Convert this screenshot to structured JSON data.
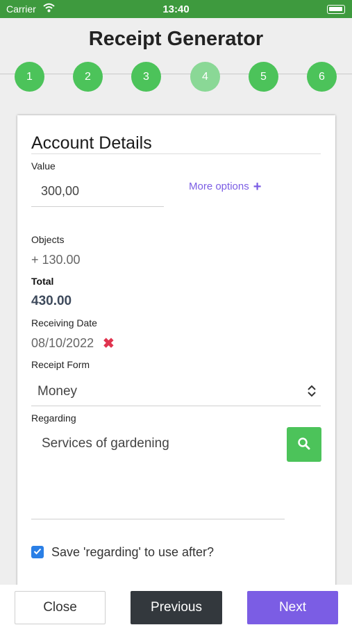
{
  "status_bar": {
    "carrier": "Carrier",
    "time": "13:40"
  },
  "app": {
    "title": "Receipt Generator"
  },
  "stepper": {
    "steps": [
      "1",
      "2",
      "3",
      "4",
      "5",
      "6"
    ],
    "current": "4"
  },
  "form": {
    "section_title": "Account Details",
    "value": {
      "label": "Value",
      "value": "300,00"
    },
    "more_options_label": "More options",
    "objects": {
      "label": "Objects",
      "value": "+ 130.00"
    },
    "total": {
      "label": "Total",
      "value": "430.00"
    },
    "receiving_date": {
      "label": "Receiving Date",
      "value": "08/10/2022",
      "clear_glyph": "✖"
    },
    "receipt_form": {
      "label": "Receipt Form",
      "selected": "Money"
    },
    "regarding": {
      "label": "Regarding",
      "value": "Services of gardening"
    },
    "save_regarding": {
      "label": "Save 'regarding' to use after?",
      "checked": true
    }
  },
  "footer": {
    "close_label": "Close",
    "previous_label": "Previous",
    "next_label": "Next"
  },
  "colors": {
    "accent_green": "#4cc35a",
    "status_green": "#3e9a3e",
    "purple": "#7b5de4",
    "dark": "#33383d",
    "delete_red": "#e0344f",
    "checkbox_blue": "#2a7fe6"
  },
  "icons": {
    "wifi": "wifi-icon",
    "battery": "battery-icon",
    "plus": "plus-icon",
    "clear": "close-icon",
    "select": "chevron-up-down-icon",
    "search": "search-icon",
    "check": "checkmark-icon"
  }
}
